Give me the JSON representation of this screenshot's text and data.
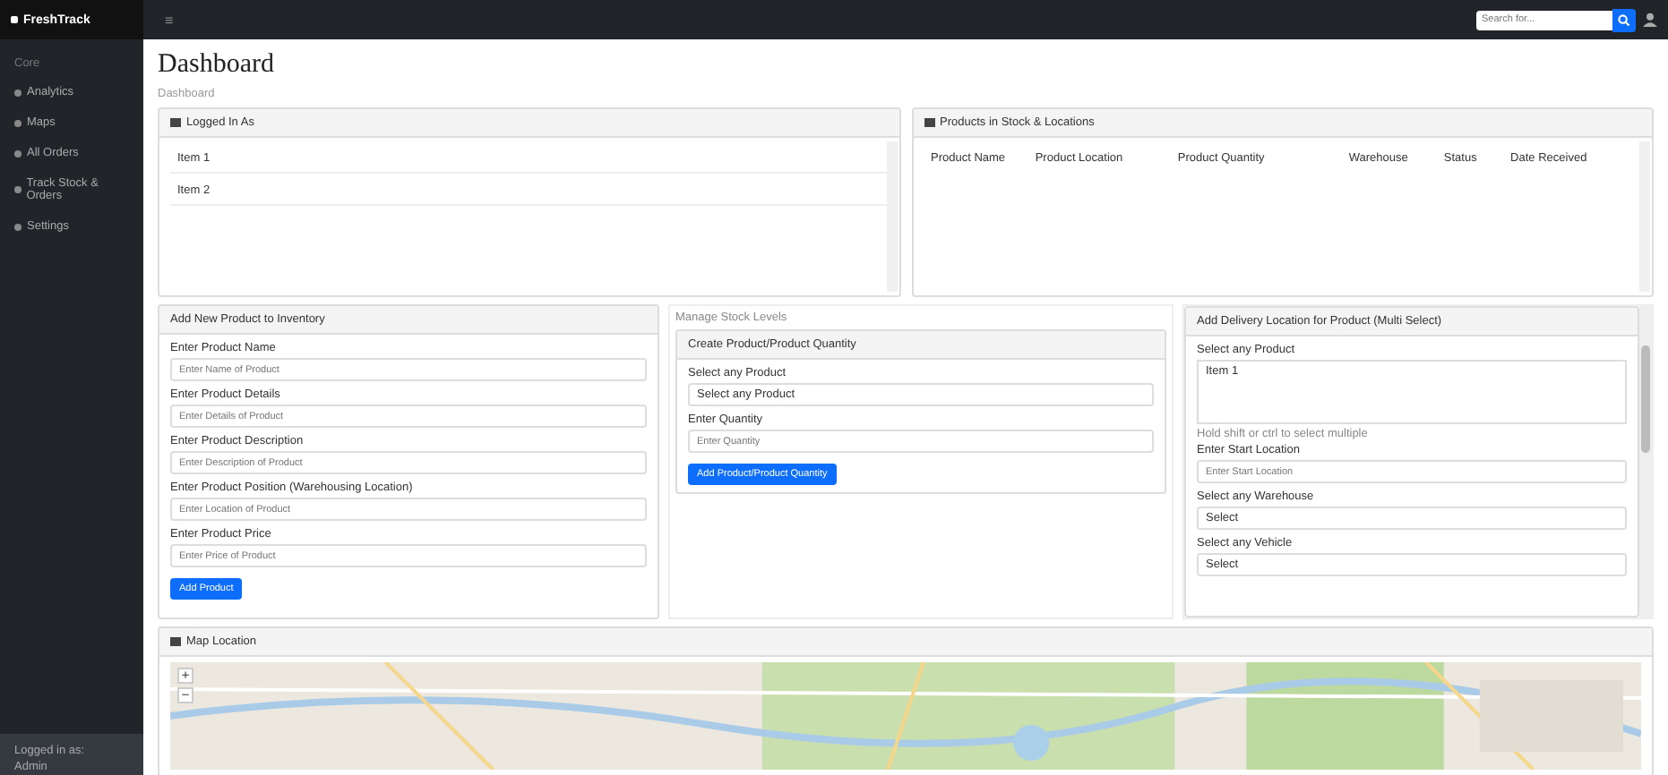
{
  "brand": "FreshTrack",
  "sidebar": {
    "heading": "Core",
    "items": [
      {
        "label": "Analytics",
        "selected": false
      },
      {
        "label": "Maps",
        "selected": false
      },
      {
        "label": "All Orders",
        "selected": false
      },
      {
        "label": "Track Stock & Orders",
        "selected": false
      },
      {
        "label": "Settings",
        "selected": false
      }
    ],
    "footer": [
      "Logged in as:",
      "Admin"
    ]
  },
  "topbar": {
    "toggle": "≡",
    "search": {
      "placeholder": "Search for..."
    }
  },
  "page": {
    "title": "Dashboard",
    "breadcrumb": "Dashboard"
  },
  "logged_panel": {
    "title": "Logged In As",
    "items": [
      "Item 1",
      "Item 2"
    ]
  },
  "stock_panel": {
    "title": "Products in Stock & Locations",
    "columns": [
      "Product Name",
      "Product Location",
      "Product Quantity",
      "Warehouse",
      "Status",
      "Date Received"
    ]
  },
  "add_product": {
    "title": "Add New Product to Inventory",
    "fields": [
      {
        "label": "Enter Product Name",
        "placeholder": "Enter Name of Product"
      },
      {
        "label": "Enter Product Details",
        "placeholder": "Enter Details of Product"
      },
      {
        "label": "Enter Product Description",
        "placeholder": "Enter Description of Product"
      },
      {
        "label": "Enter Product Position (Warehousing Location)",
        "placeholder": "Enter Location of Product"
      },
      {
        "label": "Enter Product Price",
        "placeholder": "Enter Price of Product"
      }
    ],
    "button": "Add Product"
  },
  "stock_levels": {
    "heading": "Manage Stock Levels",
    "title": "Create Product/Product Quantity",
    "fields": [
      {
        "kind": "select",
        "label": "Select any Product",
        "value": "Select any Product"
      },
      {
        "kind": "input",
        "label": "Enter Quantity",
        "placeholder": "Enter Quantity"
      }
    ],
    "button": "Add Product/Product Quantity"
  },
  "delivery": {
    "title": "Add Delivery Location for Product (Multi Select)",
    "product_label": "Select any Product",
    "options": [
      "Item 1"
    ],
    "hint": "Hold shift or ctrl to select multiple",
    "fields": [
      {
        "kind": "input",
        "label": "Enter Start Location",
        "placeholder": "Enter Start Location"
      },
      {
        "kind": "select",
        "label": "Select any Warehouse",
        "value": "Select"
      },
      {
        "kind": "select",
        "label": "Select any Vehicle",
        "value": "Select"
      }
    ]
  },
  "map_panel": {
    "title": "Map Location",
    "zoom_buttons": [
      "+",
      "−"
    ]
  }
}
